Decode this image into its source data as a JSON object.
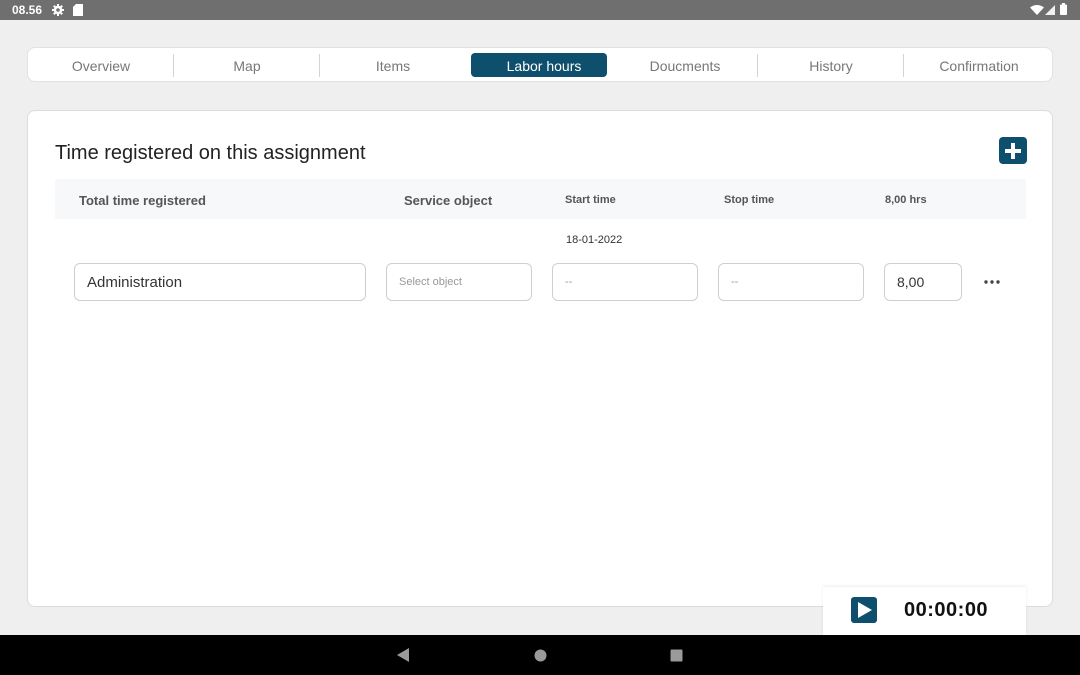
{
  "status_bar": {
    "time": "08.56"
  },
  "tabs": [
    {
      "label": "Overview"
    },
    {
      "label": "Map"
    },
    {
      "label": "Items"
    },
    {
      "label": "Labor hours",
      "active": true
    },
    {
      "label": "Doucments"
    },
    {
      "label": "History"
    },
    {
      "label": "Confirmation"
    }
  ],
  "card": {
    "title": "Time registered on this assignment",
    "columns": {
      "total_time": "Total time registered",
      "service_object": "Service object",
      "start_time": "Start time",
      "stop_time": "Stop time",
      "total_hours": "8,00 hrs"
    },
    "entry": {
      "date": "18-01-2022",
      "activity": "Administration",
      "service_object_placeholder": "Select object",
      "start_placeholder": "--",
      "stop_placeholder": "--",
      "hours": "8,00"
    }
  },
  "timer": {
    "display": "00:00:00"
  },
  "colors": {
    "accent": "#0d4f6c",
    "background": "#efefef",
    "status_bar": "#6f6f6f"
  }
}
